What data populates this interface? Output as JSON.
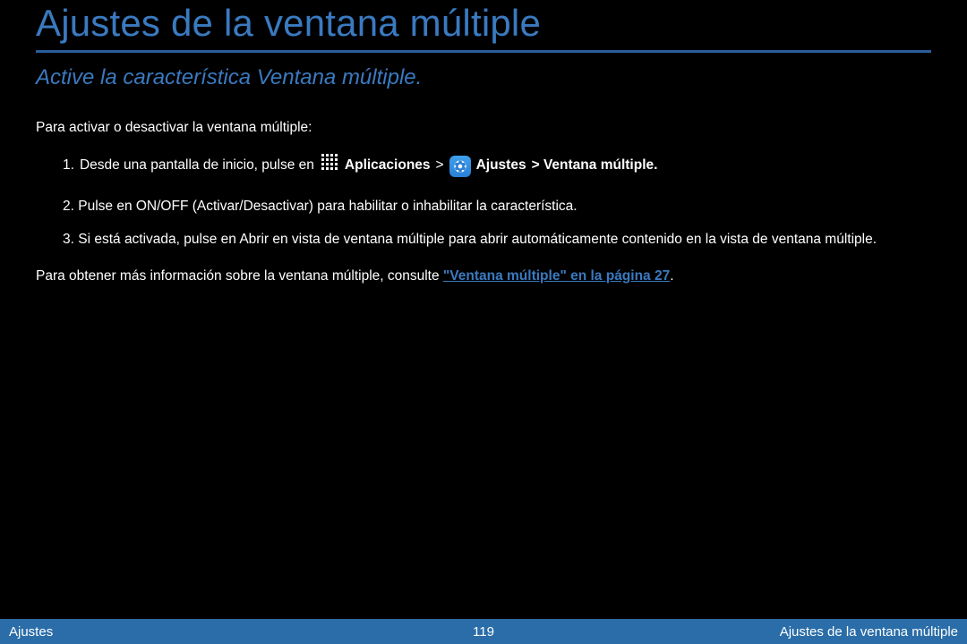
{
  "title": "Ajustes de la ventana múltiple",
  "subtitle": "Active la característica Ventana múltiple.",
  "intro": "Para activar o desactivar la ventana múltiple:",
  "step1": {
    "num": "1.",
    "seg1": "Desde una pantalla de inicio, pulse en",
    "apps_label": "Aplicaciones",
    "seg2": ">",
    "settings_label": "Ajustes",
    "seg3": "> Ventana múltiple."
  },
  "step2": {
    "num": "2.",
    "text": "Pulse en ON/OFF (Activar/Desactivar) para habilitar o inhabilitar la característica."
  },
  "step3": {
    "num": "3.",
    "text": "Si está activada, pulse en Abrir en vista de ventana múltiple para abrir automáticamente contenido en la vista de ventana múltiple."
  },
  "link_line": {
    "prefix": "Para obtener más información sobre la ventana múltiple, consulte",
    "link": "\"Ventana múltiple\" en la página 27",
    "suffix": "."
  },
  "footer": {
    "left": "Ajustes",
    "center": "119",
    "right": "Ajustes de la ventana múltiple"
  }
}
